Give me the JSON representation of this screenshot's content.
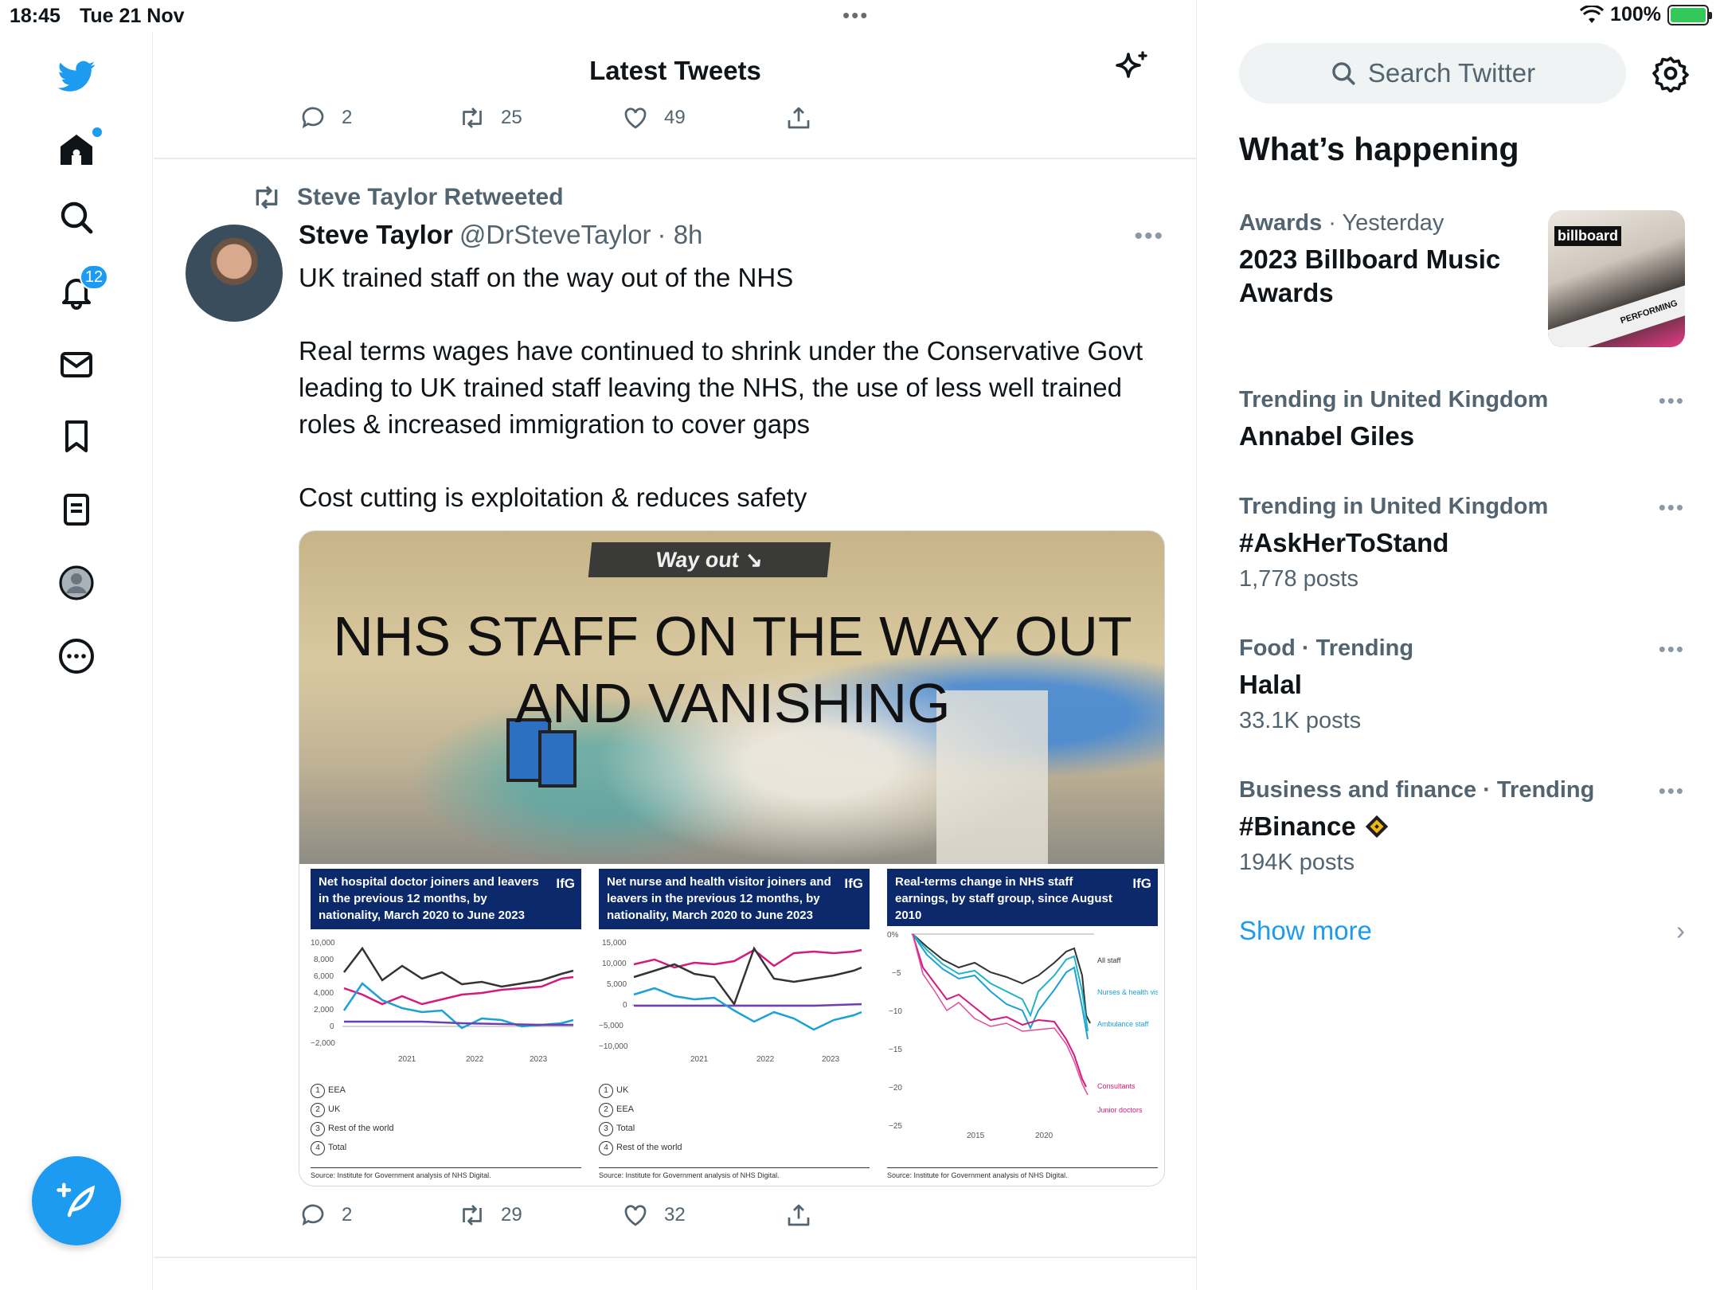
{
  "status_bar": {
    "time": "18:45",
    "date": "Tue 21 Nov",
    "battery": "100%",
    "multitask_dots": "•••"
  },
  "nav": {
    "notifications_badge": "12",
    "icons": [
      "twitter-bird-icon",
      "home-icon",
      "search-icon",
      "bell-icon",
      "mail-icon",
      "bookmark-icon",
      "lists-icon",
      "profile-icon",
      "more-icon",
      "compose-icon"
    ]
  },
  "header": {
    "title": "Latest Tweets"
  },
  "prev_tweet": {
    "replies": "2",
    "retweets": "25",
    "likes": "49"
  },
  "tweet": {
    "retweeted_by": "Steve Taylor Retweeted",
    "name": "Steve Taylor",
    "handle": "@DrSteveTaylor",
    "time": "· 8h",
    "more": "•••",
    "text": "UK trained staff on the way out of the NHS\n\nReal terms wages have continued to shrink under the Conservative Govt leading to UK trained staff leaving the NHS, the use of less well trained roles & increased immigration to cover gaps\n\nCost cutting is exploitation & reduces safety",
    "image": {
      "sign": "Way out ↘",
      "title_line1": "NHS STAFF ON THE WAY OUT",
      "title_line2": "AND VANISHING",
      "charts": [
        {
          "title": "Net hospital doctor joiners and leavers in the previous 12 months, by nationality, March 2020 to June 2023",
          "brand": "IfG",
          "y_ticks": [
            "10,000",
            "8,000",
            "6,000",
            "4,000",
            "2,000",
            "0",
            "−2,000"
          ],
          "x_ticks": [
            "2021",
            "2022",
            "2023"
          ],
          "legend": [
            {
              "num": "1",
              "label": "EEA"
            },
            {
              "num": "2",
              "label": "UK"
            },
            {
              "num": "3",
              "label": "Rest of the world"
            },
            {
              "num": "4",
              "label": "Total"
            }
          ],
          "source": "Source: Institute for Government analysis of NHS Digital."
        },
        {
          "title": "Net nurse and health visitor joiners and leavers in the previous 12 months, by nationality, March 2020 to June 2023",
          "brand": "IfG",
          "y_ticks": [
            "15,000",
            "10,000",
            "5,000",
            "0",
            "−5,000",
            "−10,000"
          ],
          "x_ticks": [
            "2021",
            "2022",
            "2023"
          ],
          "legend": [
            {
              "num": "1",
              "label": "UK"
            },
            {
              "num": "2",
              "label": "EEA"
            },
            {
              "num": "3",
              "label": "Total"
            },
            {
              "num": "4",
              "label": "Rest of the world"
            }
          ],
          "source": "Source: Institute for Government analysis of NHS Digital."
        },
        {
          "title": "Real-terms change in NHS staff earnings, by staff group, since August 2010",
          "brand": "IfG",
          "y_ticks": [
            "0%",
            "−5",
            "−10",
            "−15",
            "−20",
            "−25"
          ],
          "x_ticks": [
            "2015",
            "2020"
          ],
          "annotations": [
            "All staff",
            "Nurses & health visitors",
            "Ambulance staff",
            "Consultants",
            "Junior doctors"
          ],
          "source": "Source: Institute for Government analysis of NHS Digital."
        }
      ]
    },
    "replies": "2",
    "retweets": "29",
    "likes": "32"
  },
  "sidebar": {
    "search_placeholder": "Search Twitter",
    "section_title": "What’s happening",
    "trends": [
      {
        "meta": "Awards",
        "meta_extra": "· Yesterday",
        "title": "2023 Billboard Music Awards",
        "count": "",
        "has_image": true,
        "image_logo": "billboard",
        "image_band": "PERFORMING"
      },
      {
        "meta": "Trending in United Kingdom",
        "title": "Annabel Giles",
        "count": ""
      },
      {
        "meta": "Trending in United Kingdom",
        "title": "#AskHerToStand",
        "count": "1,778 posts"
      },
      {
        "meta": "Food · Trending",
        "title": "Halal",
        "count": "33.1K posts"
      },
      {
        "meta": "Business and finance · Trending",
        "title": "#Binance",
        "count": "194K posts"
      }
    ],
    "show_more": "Show more",
    "colors": {
      "accent": "#1d9bf0",
      "muted": "#536471"
    }
  }
}
